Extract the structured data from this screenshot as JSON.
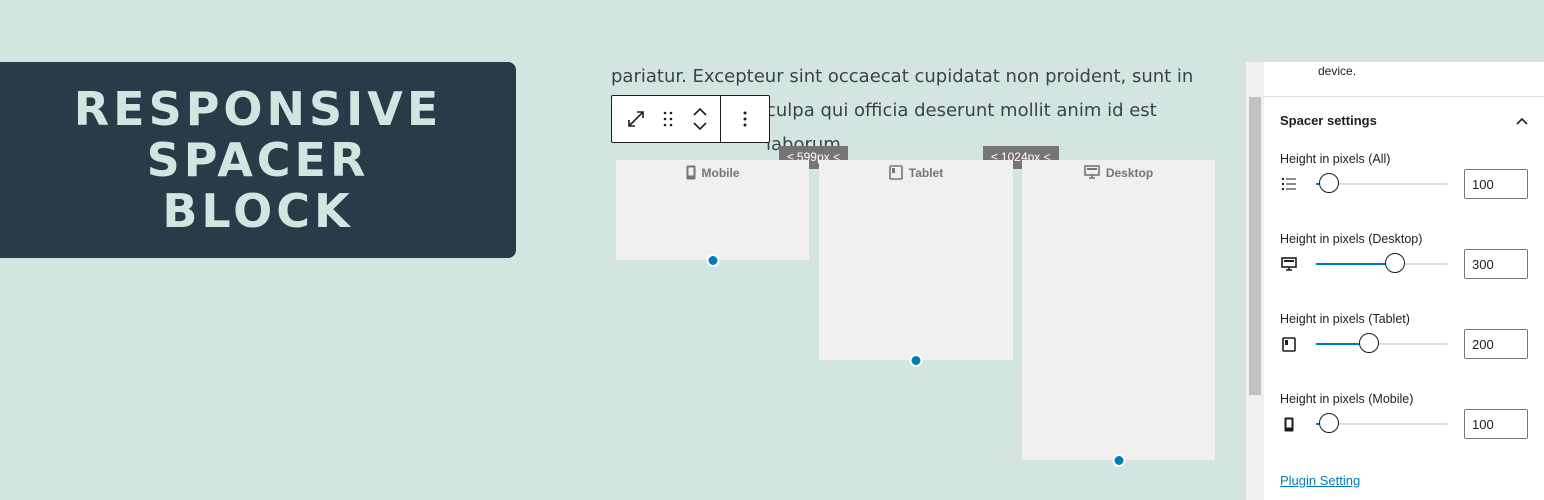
{
  "banner": {
    "title_line1": "RESPONSIVE",
    "title_line2": "SPACER",
    "title_line3": "BLOCK"
  },
  "content": {
    "paragraph_line1": "pariatur. Excepteur sint occaecat cupidatat non proident, sunt in",
    "paragraph_line2": "culpa qui officia deserunt mollit anim id est laborum."
  },
  "toolbar": {
    "icons": [
      "expand-icon",
      "drag-handle-icon",
      "move-up-icon",
      "move-down-icon",
      "more-options-icon"
    ]
  },
  "preview": {
    "breakpoints": {
      "mobile_max": "≤ 599px <",
      "tablet_max": "≤ 1024px <"
    },
    "zones": [
      {
        "label": "Mobile",
        "icon": "mobile-icon",
        "height": 100
      },
      {
        "label": "Tablet",
        "icon": "tablet-icon",
        "height": 200
      },
      {
        "label": "Desktop",
        "icon": "desktop-icon",
        "height": 300
      }
    ]
  },
  "sidebar": {
    "note": "device.",
    "panel_title": "Spacer settings",
    "slider_max": 1000,
    "controls": [
      {
        "label": "Height in pixels (All)",
        "icon": "list-icon",
        "value": "100",
        "level": 0.1
      },
      {
        "label": "Height in pixels (Desktop)",
        "icon": "desktop-icon",
        "value": "300",
        "level": 0.6
      },
      {
        "label": "Height in pixels (Tablet)",
        "icon": "tablet-icon",
        "value": "200",
        "level": 0.4
      },
      {
        "label": "Height in pixels (Mobile)",
        "icon": "mobile-icon",
        "value": "100",
        "level": 0.1
      }
    ],
    "plugin_link": "Plugin Setting"
  },
  "colors": {
    "accent": "#007cba",
    "banner_bg": "#2b3a48",
    "page_bg": "#d2e5e0",
    "zone_bg": "#f0f0f0"
  }
}
